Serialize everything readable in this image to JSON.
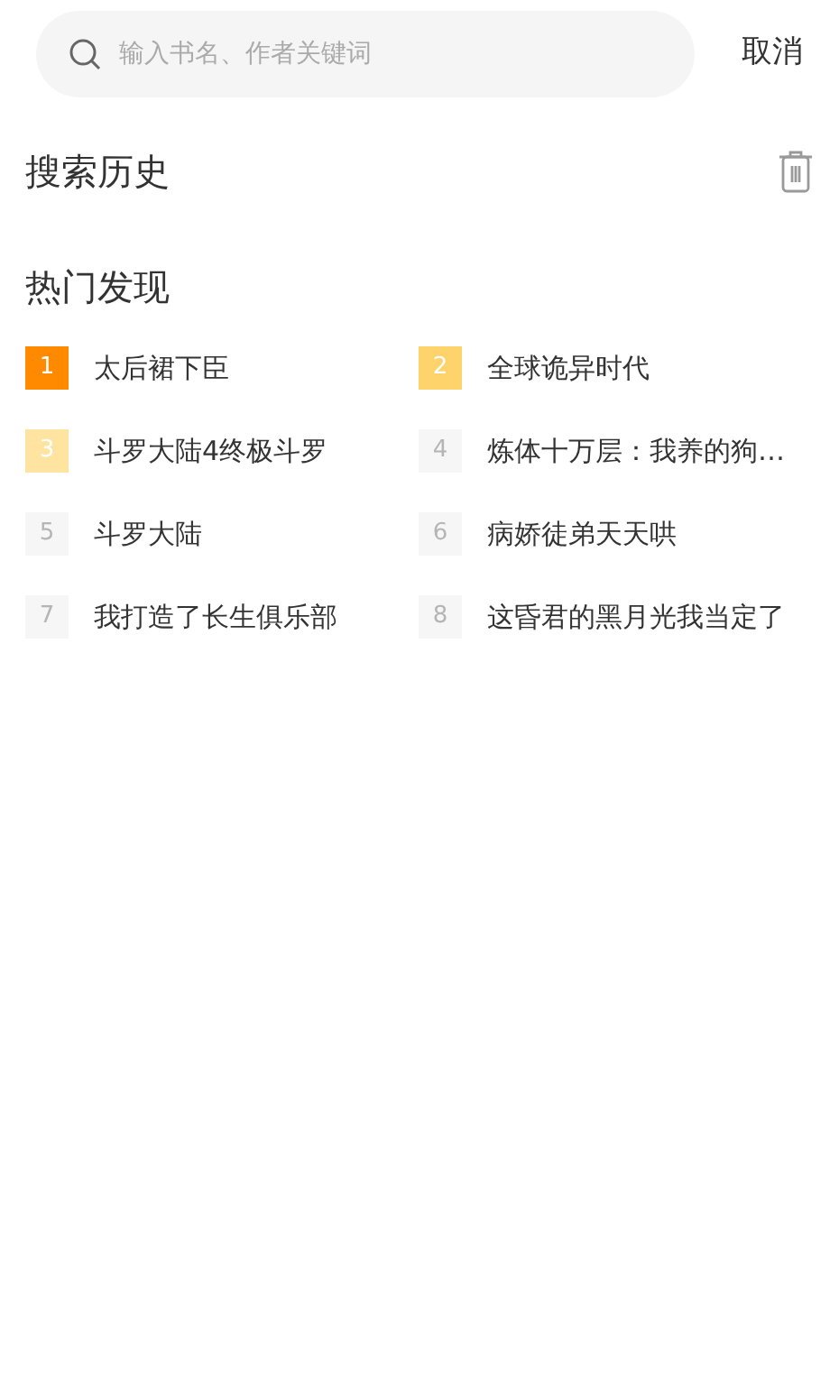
{
  "search": {
    "placeholder": "输入书名、作者关键词"
  },
  "cancel": "取消",
  "history": {
    "title": "搜索历史"
  },
  "hot": {
    "title": "热门发现",
    "items": [
      {
        "rank": "1",
        "title": "太后裙下臣",
        "color": "#ff8a00"
      },
      {
        "rank": "2",
        "title": "全球诡异时代",
        "color": "#ffd36b"
      },
      {
        "rank": "3",
        "title": "斗罗大陆4终极斗罗",
        "color": "#ffe3a0"
      },
      {
        "rank": "4",
        "title": "炼体十万层：我养的狗…",
        "color": "#f6f6f6"
      },
      {
        "rank": "5",
        "title": "斗罗大陆",
        "color": "#f6f6f6"
      },
      {
        "rank": "6",
        "title": "病娇徒弟天天哄",
        "color": "#f6f6f6"
      },
      {
        "rank": "7",
        "title": "我打造了长生俱乐部",
        "color": "#f6f6f6"
      },
      {
        "rank": "8",
        "title": "这昏君的黑月光我当定了",
        "color": "#f6f6f6"
      }
    ]
  }
}
